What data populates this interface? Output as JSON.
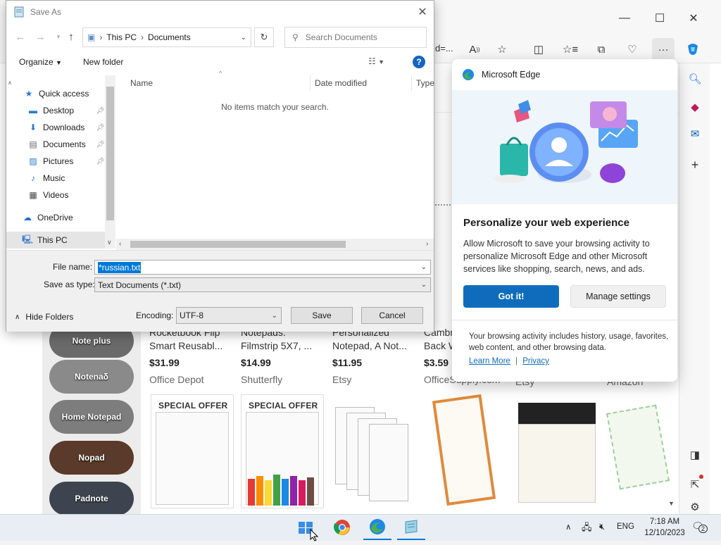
{
  "edge": {
    "address_fragment": "d=...",
    "toolbar_icons": [
      "read-aloud-icon",
      "favorite-star-icon",
      "split-screen-icon",
      "favorites-icon",
      "collections-icon",
      "browser-essentials-icon",
      "more-icon",
      "copilot-icon"
    ],
    "sidebar_icons": [
      "search-icon",
      "office-icon",
      "outlook-icon",
      "add-icon"
    ],
    "side_pills": [
      "Note plus",
      "Notenaδ",
      "Home Notepad",
      "Nopad",
      "Padnote"
    ],
    "products": [
      {
        "title_line1": "Rocketbook Flip",
        "title_line2": "Smart Reusabl...",
        "price": "$31.99",
        "store": "Office Depot"
      },
      {
        "title_line1": "Notepads:",
        "title_line2": "Filmstrip 5X7, ...",
        "price": "$14.99",
        "store": "Shutterfly"
      },
      {
        "title_line1": "Personalized",
        "title_line2": "Notepad, A Not...",
        "price": "$11.95",
        "store": "Etsy"
      },
      {
        "title_line1": "Cambr",
        "title_line2": "Back W",
        "price": "$3.59",
        "store": "OfficeSupply.com"
      }
    ],
    "extra_stores": [
      "Etsy",
      "Amazon"
    ],
    "special_offer": "SPECIAL OFFER"
  },
  "popup": {
    "header": "Microsoft Edge",
    "title": "Personalize your web experience",
    "body": "Allow Microsoft to save your browsing activity to personalize Microsoft Edge and other Microsoft services like shopping, search, news, and ads.",
    "got_it": "Got it!",
    "manage": "Manage settings",
    "footer": "Your browsing activity includes history, usage, favorites, web content, and other browsing data.",
    "learn_more": "Learn More",
    "separator": "|",
    "privacy": "Privacy"
  },
  "dialog": {
    "title": "Save As",
    "breadcrumb": [
      "This PC",
      "Documents"
    ],
    "search_placeholder": "Search Documents",
    "organize": "Organize",
    "new_folder": "New folder",
    "nav": [
      {
        "label": "Quick access",
        "icon": "star-icon",
        "pinned": false
      },
      {
        "label": "Desktop",
        "icon": "desktop-icon",
        "pinned": true
      },
      {
        "label": "Downloads",
        "icon": "download-icon",
        "pinned": true
      },
      {
        "label": "Documents",
        "icon": "documents-icon",
        "pinned": true
      },
      {
        "label": "Pictures",
        "icon": "pictures-icon",
        "pinned": true
      },
      {
        "label": "Music",
        "icon": "music-icon",
        "pinned": false
      },
      {
        "label": "Videos",
        "icon": "videos-icon",
        "pinned": false
      },
      {
        "label": "OneDrive",
        "icon": "cloud-icon",
        "pinned": false
      },
      {
        "label": "This PC",
        "icon": "computer-icon",
        "pinned": false
      }
    ],
    "columns": [
      "Name",
      "Date modified",
      "Type"
    ],
    "empty_message": "No items match your search.",
    "file_name_label": "File name:",
    "file_name_value": "*russian.txt",
    "save_type_label": "Save as type:",
    "save_type_value": "Text Documents (*.txt)",
    "hide_folders": "Hide Folders",
    "encoding_label": "Encoding:",
    "encoding_value": "UTF-8",
    "save": "Save",
    "cancel": "Cancel"
  },
  "taskbar": {
    "time": "7:18 AM",
    "date": "12/10/2023",
    "language": "ENG",
    "notification_count": "2"
  },
  "colors": {
    "accent": "#0f6cbd",
    "selection": "#0078d7"
  }
}
